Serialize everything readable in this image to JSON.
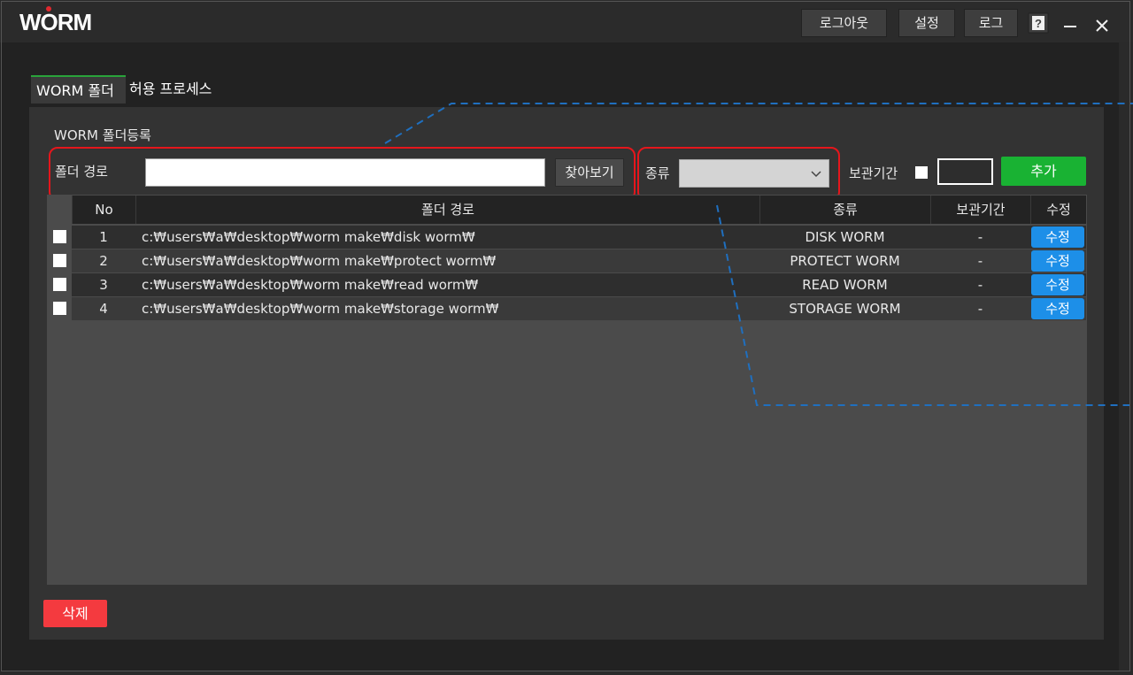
{
  "app": {
    "logo": "WORM"
  },
  "toolbar": {
    "logout": "로그아웃",
    "settings": "설정",
    "log": "로그"
  },
  "tabs": [
    {
      "label": "WORM 폴더"
    },
    {
      "label": "허용 프로세스"
    }
  ],
  "form": {
    "section_title": "WORM 폴더등록",
    "path_label": "폴더 경로",
    "path_value": "",
    "browse_label": "찾아보기",
    "type_label": "종류",
    "type_value": "",
    "retention_label": "보관기간",
    "retention_value": "",
    "add_label": "추가"
  },
  "table": {
    "headers": [
      "No",
      "폴더 경로",
      "종류",
      "보관기간",
      "수정"
    ],
    "rows": [
      {
        "no": "1",
        "path": "c:₩users₩a₩desktop₩worm make₩disk worm₩",
        "type": "DISK WORM",
        "retention": "-",
        "edit": "수정"
      },
      {
        "no": "2",
        "path": "c:₩users₩a₩desktop₩worm make₩protect worm₩",
        "type": "PROTECT WORM",
        "retention": "-",
        "edit": "수정"
      },
      {
        "no": "3",
        "path": "c:₩users₩a₩desktop₩worm make₩read worm₩",
        "type": "READ WORM",
        "retention": "-",
        "edit": "수정"
      },
      {
        "no": "4",
        "path": "c:₩users₩a₩desktop₩worm make₩storage worm₩",
        "type": "STORAGE WORM",
        "retention": "-",
        "edit": "수정"
      }
    ]
  },
  "footer": {
    "delete_label": "삭제"
  },
  "colors": {
    "accent_green": "#19b233",
    "edit_blue": "#1d8fe8",
    "delete_red": "#f43a3f",
    "highlight_red": "#e5161c",
    "callout_blue": "#1f6fbf"
  }
}
